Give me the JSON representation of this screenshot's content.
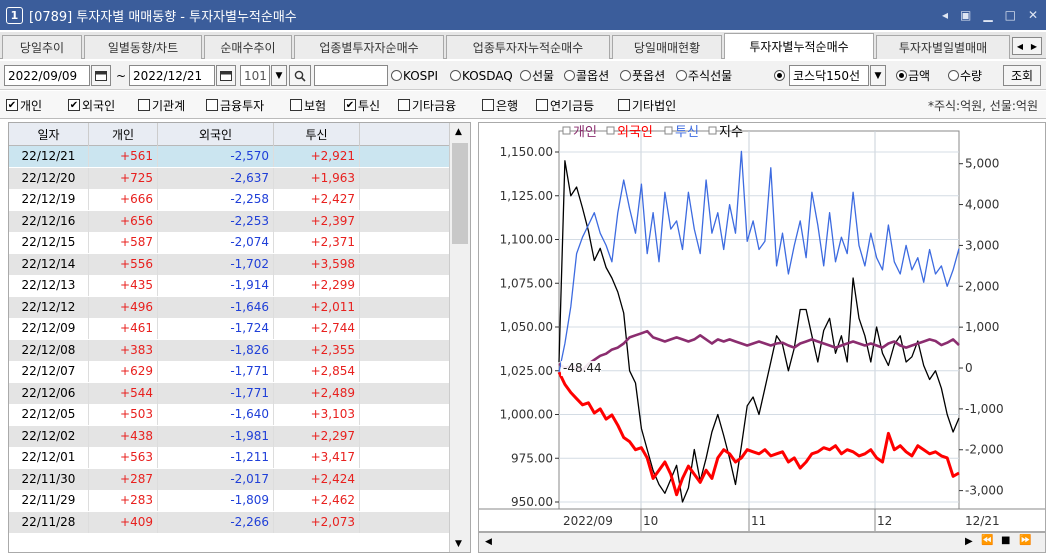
{
  "window": {
    "badge": "1",
    "title": "[0789] 투자자별 매매동향 - 투자자별누적순매수",
    "controls": [
      "◂",
      "▣",
      "▁",
      "□",
      "✕"
    ]
  },
  "tabs": [
    "당일추이",
    "일별동향/차트",
    "순매수추이",
    "업종별투자자순매수",
    "업종투자자누적순매수",
    "당일매매현황",
    "투자자별누적순매수",
    "투자자별일별매매"
  ],
  "active_tab": 6,
  "tab_nav": [
    "◀",
    "▶"
  ],
  "toolbar": {
    "start_date": "2022/09/09",
    "range_sep": "~",
    "end_date": "2022/12/21",
    "code": "101",
    "calendar_icon": "calendar-icon",
    "search_icon": "search-icon",
    "market_options": [
      "KOSPI",
      "KOSDAQ",
      "선물",
      "콜옵션",
      "풋옵션",
      "주식선물"
    ],
    "index_select": "코스닥150선",
    "view_options": [
      "금액",
      "수량"
    ],
    "view_selected": "금액",
    "query_button": "조회"
  },
  "investor_filters": [
    {
      "label": "개인",
      "checked": true
    },
    {
      "label": "외국인",
      "checked": true
    },
    {
      "label": "기관계",
      "checked": false
    },
    {
      "label": "금융투자",
      "checked": false
    },
    {
      "label": "보험",
      "checked": false
    },
    {
      "label": "투신",
      "checked": true
    },
    {
      "label": "기타금융",
      "checked": false
    },
    {
      "label": "은행",
      "checked": false
    },
    {
      "label": "연기금등",
      "checked": false
    },
    {
      "label": "기타법인",
      "checked": false
    }
  ],
  "unit_note": "*주식:억원, 선물:억원",
  "table": {
    "headers": [
      "일자",
      "개인",
      "외국인",
      "투신"
    ],
    "rows": [
      [
        "22/12/21",
        "+561",
        "-2,570",
        "+2,921"
      ],
      [
        "22/12/20",
        "+725",
        "-2,637",
        "+1,963"
      ],
      [
        "22/12/19",
        "+666",
        "-2,258",
        "+2,427"
      ],
      [
        "22/12/16",
        "+656",
        "-2,253",
        "+2,397"
      ],
      [
        "22/12/15",
        "+587",
        "-2,074",
        "+2,371"
      ],
      [
        "22/12/14",
        "+556",
        "-1,702",
        "+3,598"
      ],
      [
        "22/12/13",
        "+435",
        "-1,914",
        "+2,299"
      ],
      [
        "22/12/12",
        "+496",
        "-1,646",
        "+2,011"
      ],
      [
        "22/12/09",
        "+461",
        "-1,724",
        "+2,744"
      ],
      [
        "22/12/08",
        "+383",
        "-1,826",
        "+2,355"
      ],
      [
        "22/12/07",
        "+629",
        "-1,771",
        "+2,854"
      ],
      [
        "22/12/06",
        "+544",
        "-1,771",
        "+2,489"
      ],
      [
        "22/12/05",
        "+503",
        "-1,640",
        "+3,103"
      ],
      [
        "22/12/02",
        "+438",
        "-1,981",
        "+2,297"
      ],
      [
        "22/12/01",
        "+563",
        "-1,211",
        "+3,417"
      ],
      [
        "22/11/30",
        "+287",
        "-2,017",
        "+2,424"
      ],
      [
        "22/11/29",
        "+283",
        "-1,809",
        "+2,462"
      ],
      [
        "22/11/28",
        "+409",
        "-2,266",
        "+2,073"
      ]
    ],
    "selected_row": 0
  },
  "colors": {
    "positive": "#e8201e",
    "negative": "#1f3fd8",
    "individual": "#8b2d6f",
    "foreign": "#ff0000",
    "trust": "#3d6be0",
    "index": "#000000",
    "selected_row": "#cbe5f0",
    "alt_row": "#e4e4e4"
  },
  "chart_data": {
    "type": "line",
    "legend": [
      "개인",
      "외국인",
      "투신",
      "지수"
    ],
    "left_axis": {
      "ticks": [
        "1,150.00",
        "1,125.00",
        "1,100.00",
        "1,075.00",
        "1,050.00",
        "1,025.00",
        "1,000.00",
        "975.00",
        "950.00"
      ],
      "range": [
        946,
        1162
      ]
    },
    "right_axis": {
      "ticks": [
        "5,000",
        "4,000",
        "3,000",
        "2,000",
        "1,000",
        "0",
        "-1,000",
        "-2,000",
        "-3,000"
      ],
      "range": [
        -3450,
        5800
      ]
    },
    "x_labels": [
      "2022/09",
      "10",
      "11",
      "12",
      "12/21"
    ],
    "annotation": "-48.44",
    "series": [
      {
        "name": "지수",
        "axis": "left",
        "values": [
          1030,
          1145,
          1125,
          1130,
          1118,
          1105,
          1088,
          1095,
          1084,
          1078,
          1070,
          1058,
          1025,
          1018,
          992,
          980,
          968,
          960,
          955,
          963,
          971,
          950,
          958,
          980,
          962,
          975,
          990,
          1000,
          988,
          975,
          960,
          982,
          1005,
          1010,
          1000,
          1015,
          1030,
          1045,
          1040,
          1025,
          1038,
          1060,
          1060,
          1045,
          1030,
          1048,
          1055,
          1035,
          1045,
          1030,
          1078,
          1055,
          1045,
          1030,
          1050,
          1035,
          1028,
          1040,
          1045,
          1030,
          1033,
          1042,
          1028,
          1020,
          1025,
          1015,
          1000,
          990,
          998
        ]
      },
      {
        "name": "개인",
        "axis": "right",
        "values": [
          100,
          0,
          50,
          0,
          -50,
          100,
          200,
          300,
          350,
          450,
          500,
          600,
          750,
          800,
          850,
          900,
          750,
          700,
          650,
          700,
          750,
          700,
          650,
          700,
          800,
          700,
          600,
          700,
          650,
          700,
          650,
          600,
          550,
          600,
          650,
          600,
          550,
          600,
          620,
          550,
          500,
          600,
          650,
          700,
          650,
          600,
          550,
          500,
          550,
          600,
          650,
          600,
          550,
          600,
          550,
          500,
          600,
          650,
          550,
          500,
          550,
          600,
          650,
          700,
          660,
          560,
          620,
          700,
          560
        ]
      },
      {
        "name": "외국인",
        "axis": "right",
        "values": [
          -100,
          -400,
          -600,
          -750,
          -900,
          -850,
          -1100,
          -1000,
          -1250,
          -1150,
          -1400,
          -1700,
          -1800,
          -2000,
          -1950,
          -2200,
          -2700,
          -2500,
          -2300,
          -2600,
          -3100,
          -2700,
          -2400,
          -2600,
          -2800,
          -2500,
          -2700,
          -2200,
          -2000,
          -2100,
          -2300,
          -2200,
          -2000,
          -2050,
          -2100,
          -2000,
          -2150,
          -2100,
          -2050,
          -2300,
          -2200,
          -2450,
          -2300,
          -2100,
          -2050,
          -1950,
          -2000,
          -1900,
          -2100,
          -2000,
          -2050,
          -2150,
          -2100,
          -2000,
          -2200,
          -2300,
          -1600,
          -2000,
          -1900,
          -2050,
          -2150,
          -1900,
          -2000,
          -2100,
          -2050,
          -2150,
          -2200,
          -2650,
          -2570
        ]
      },
      {
        "name": "투신",
        "axis": "right",
        "values": [
          -100,
          600,
          1500,
          2800,
          3200,
          3500,
          3800,
          3300,
          3000,
          2600,
          3800,
          4600,
          3900,
          3300,
          4500,
          2800,
          3800,
          2600,
          4300,
          3400,
          3600,
          2900,
          4300,
          3400,
          2800,
          4600,
          3300,
          3800,
          2900,
          4000,
          3300,
          5300,
          3100,
          3600,
          2900,
          3100,
          4900,
          2500,
          3300,
          2300,
          3000,
          3600,
          2700,
          4300,
          3500,
          2500,
          3800,
          2600,
          3200,
          2800,
          4300,
          3000,
          2500,
          3300,
          2700,
          2400,
          3500,
          2600,
          2300,
          3000,
          2400,
          2700,
          2100,
          2900,
          2300,
          2500,
          2000,
          2400,
          2921
        ]
      }
    ]
  },
  "hscroll_buttons": [
    "▶",
    "⏪",
    "■",
    "⏩"
  ]
}
